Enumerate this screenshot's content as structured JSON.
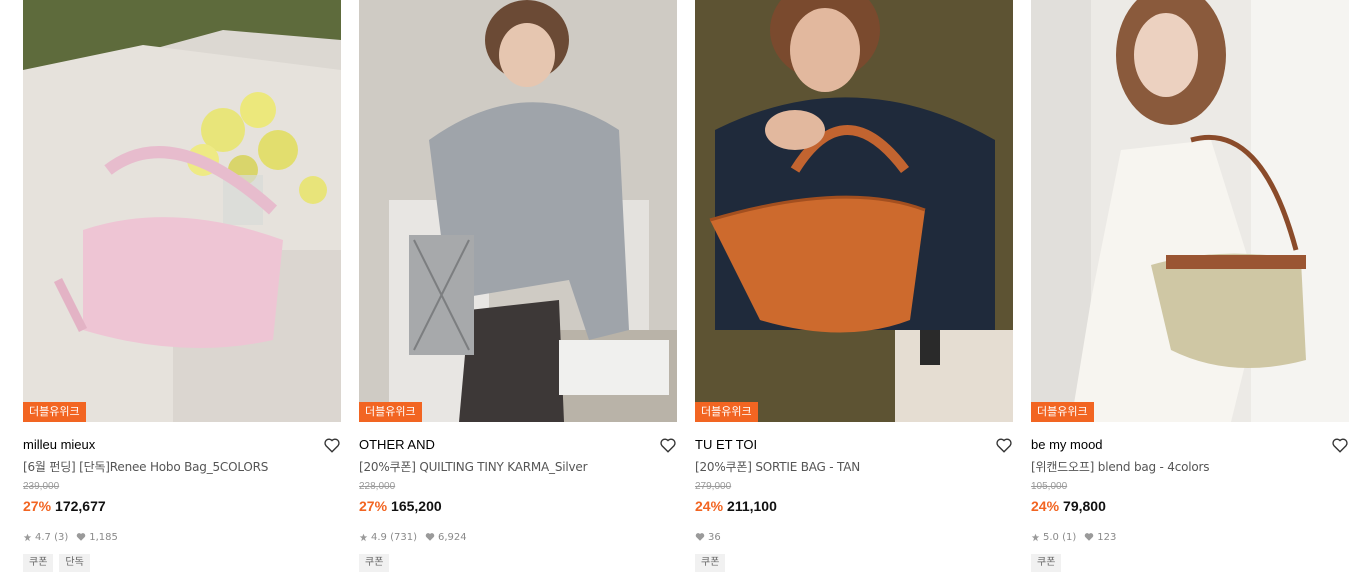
{
  "products": [
    {
      "badge": "더블유위크",
      "brand": "milleu mieux",
      "name": "[6월 펀딩] [단독]Renee Hobo Bag_5COLORS",
      "original_price": "239,000",
      "discount": "27%",
      "price": "172,677",
      "rating": "4.7 (3)",
      "likes": "1,185",
      "tags": [
        "쿠폰",
        "단독"
      ],
      "image_desc_icon": "pink-hobo-bag-photo"
    },
    {
      "badge": "더블유위크",
      "brand": "OTHER AND",
      "name": "[20%쿠폰] QUILTING TINY KARMA_Silver",
      "original_price": "228,000",
      "discount": "27%",
      "price": "165,200",
      "rating": "4.9 (731)",
      "likes": "6,924",
      "tags": [
        "쿠폰"
      ],
      "image_desc_icon": "silver-quilted-bag-photo"
    },
    {
      "badge": "더블유위크",
      "brand": "TU ET TOI",
      "name": "[20%쿠폰] SORTIE BAG - TAN",
      "original_price": "279,000",
      "discount": "24%",
      "price": "211,100",
      "rating": "",
      "likes": "36",
      "tags": [
        "쿠폰"
      ],
      "image_desc_icon": "tan-leather-bag-photo"
    },
    {
      "badge": "더블유위크",
      "brand": "be my mood",
      "name": "[위캔드오프] blend bag - 4colors",
      "original_price": "105,000",
      "discount": "24%",
      "price": "79,800",
      "rating": "5.0 (1)",
      "likes": "123",
      "tags": [
        "쿠폰"
      ],
      "image_desc_icon": "beige-shoulder-bag-photo"
    }
  ],
  "colors": {
    "accent": "#f26522",
    "badge_bg": "#f26522",
    "tag_bg": "#f1f1f1"
  }
}
